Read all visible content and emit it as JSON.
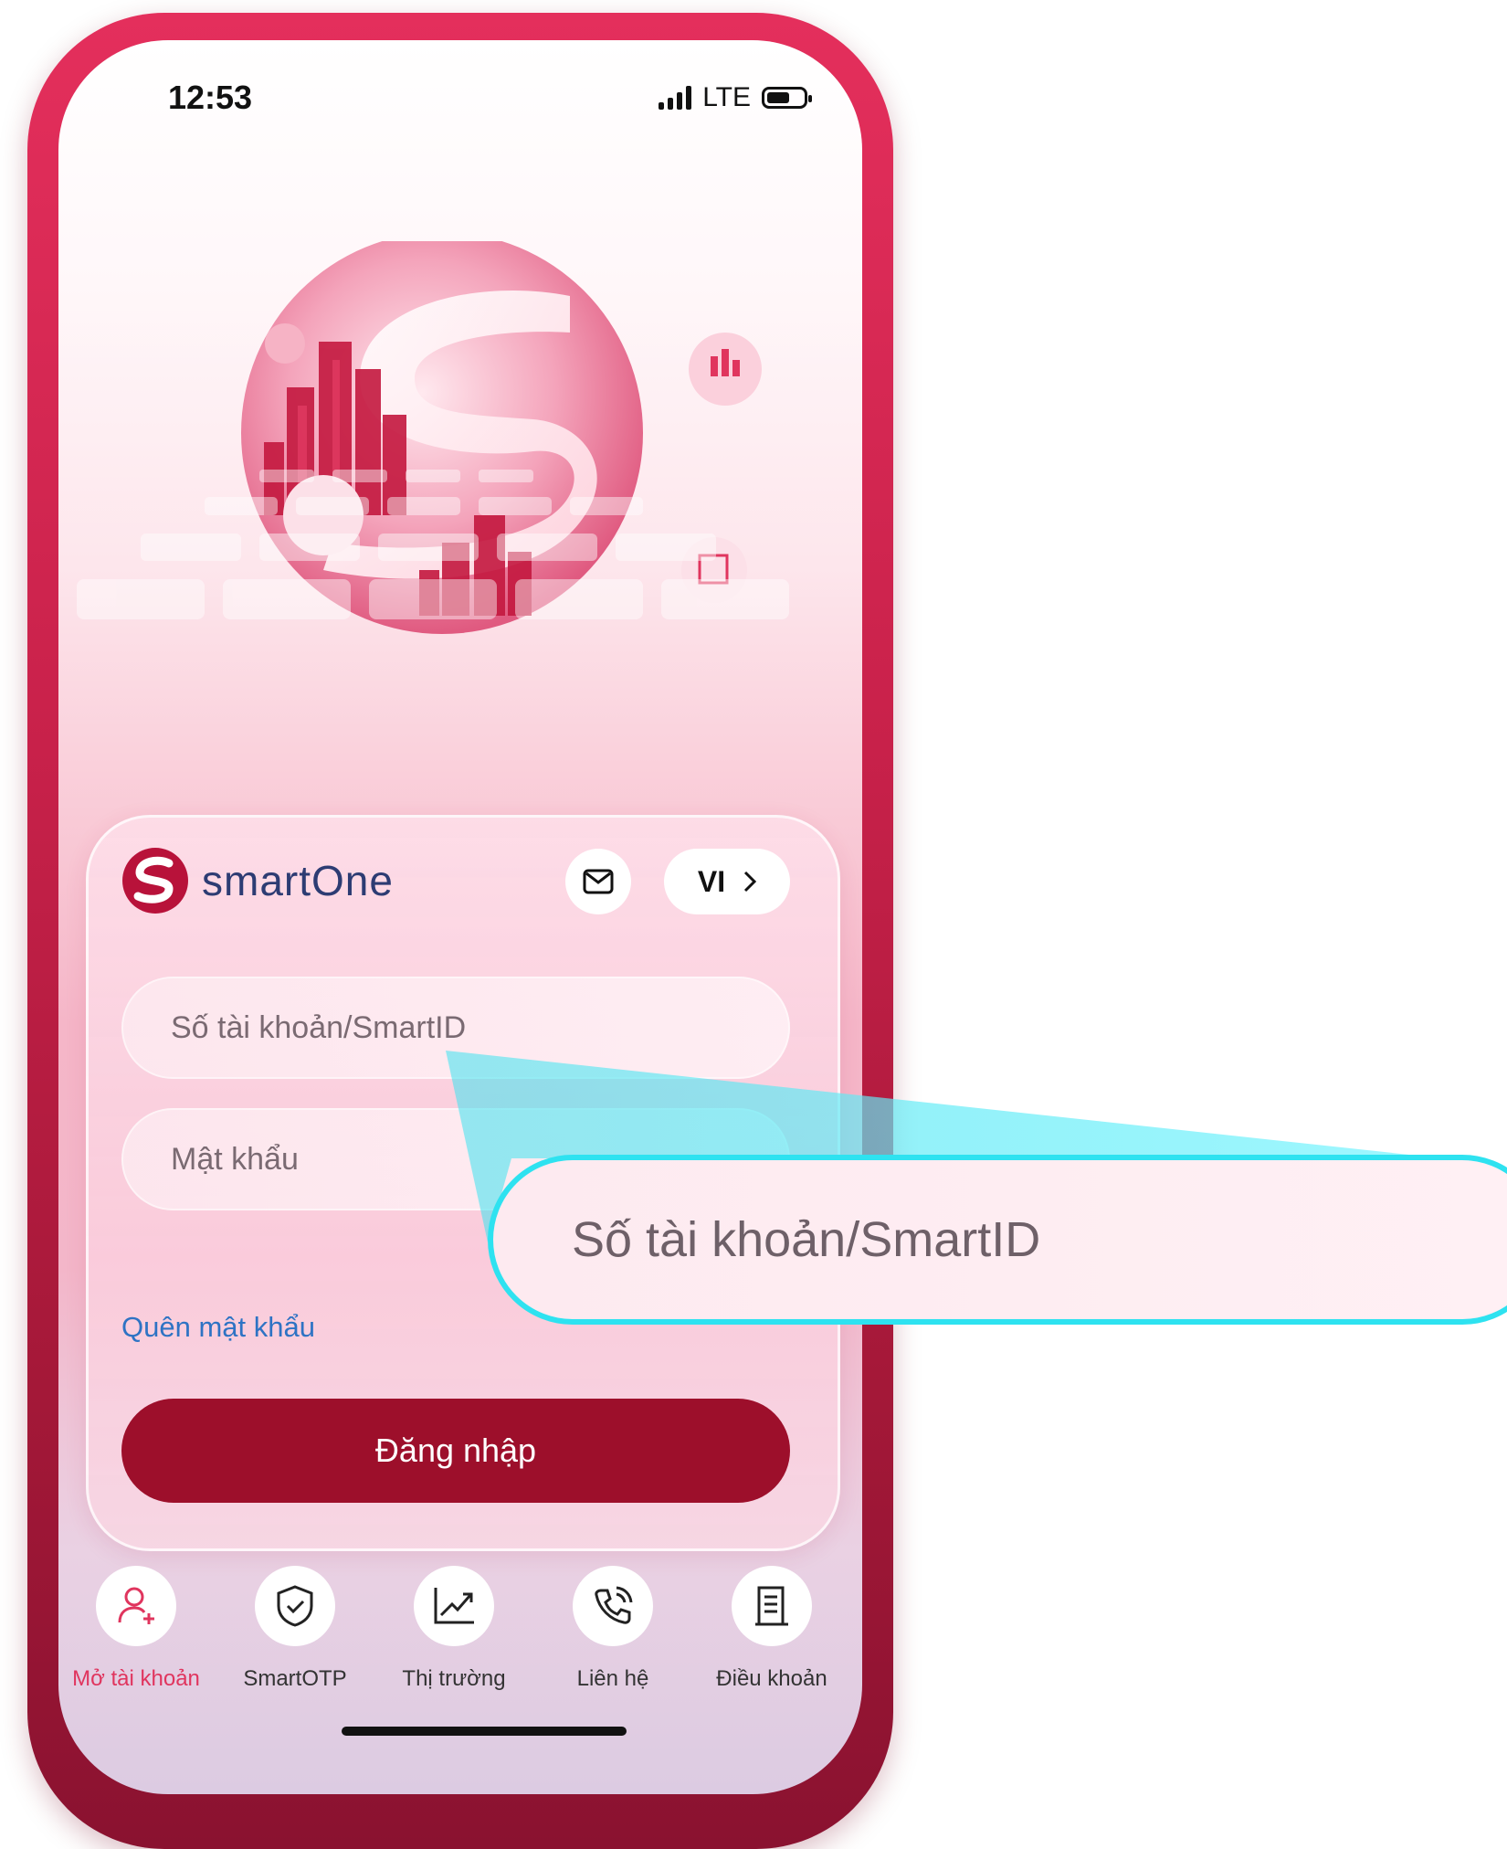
{
  "status": {
    "time": "12:53",
    "network": "LTE"
  },
  "brand": {
    "name": "smartOne"
  },
  "header": {
    "language": "VI"
  },
  "login": {
    "account_placeholder": "Số tài khoản/SmartID",
    "password_placeholder": "Mật khẩu",
    "forgot": "Quên mật khẩu",
    "submit": "Đăng nhập"
  },
  "nav": [
    {
      "label": "Mở tài khoản",
      "icon": "add-user-icon",
      "active": true
    },
    {
      "label": "SmartOTP",
      "icon": "shield-check-icon"
    },
    {
      "label": "Thị trường",
      "icon": "trend-chart-icon"
    },
    {
      "label": "Liên hệ",
      "icon": "phone-icon"
    },
    {
      "label": "Điều khoản",
      "icon": "document-icon"
    }
  ],
  "callout": {
    "text": "Số tài khoản/SmartID"
  },
  "colors": {
    "brand": "#9d0f2b",
    "accent": "#e0355e",
    "link": "#2e73c4",
    "callout_border": "#2ee2f0"
  }
}
